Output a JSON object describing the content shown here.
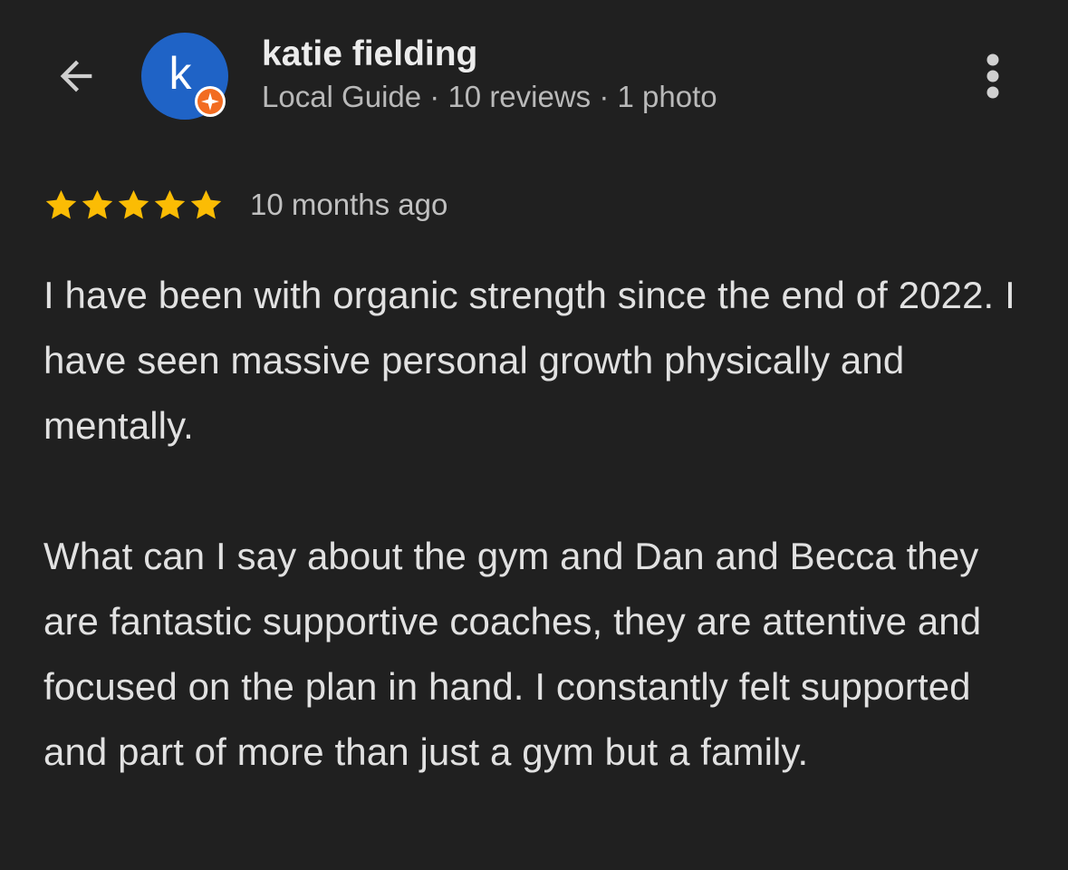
{
  "header": {
    "back_icon": "arrow-back-icon",
    "avatar_letter": "k",
    "avatar_color": "#1f63c6",
    "badge_icon": "local-guide-badge-icon",
    "badge_color": "#f26c21",
    "user_name": "katie fielding",
    "user_meta": "Local Guide · 10 reviews · 1 photo",
    "more_icon": "more-vertical-icon"
  },
  "review": {
    "rating": 5,
    "rating_max": 5,
    "star_color": "#fbbc04",
    "time": "10 months ago",
    "paragraphs": [
      "I have been with organic strength since the end of 2022. I have seen massive personal growth physically and mentally.",
      "What can I say about the gym and Dan and Becca they are fantastic supportive coaches, they are attentive and focused on the plan in hand. I constantly felt supported and part of more than just a gym but a family."
    ]
  }
}
